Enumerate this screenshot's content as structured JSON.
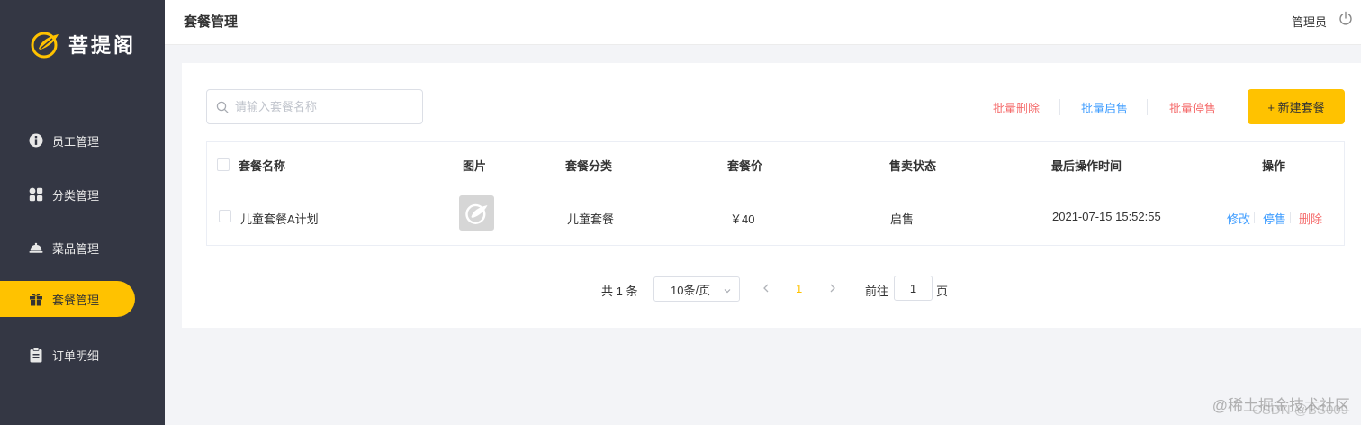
{
  "app": {
    "logo_text": "菩提阁"
  },
  "sidebar": {
    "items": [
      {
        "label": "员工管理",
        "icon": "employee-icon"
      },
      {
        "label": "分类管理",
        "icon": "category-grid-icon"
      },
      {
        "label": "菜品管理",
        "icon": "dish-cloche-icon"
      },
      {
        "label": "套餐管理",
        "icon": "gift-icon",
        "active": true
      },
      {
        "label": "订单明细",
        "icon": "clipboard-icon"
      }
    ]
  },
  "header": {
    "title": "套餐管理",
    "user": "管理员",
    "logout_icon": "power-icon"
  },
  "toolbar": {
    "search_placeholder": "请输入套餐名称",
    "batch_delete": "批量删除",
    "batch_enable": "批量启售",
    "batch_disable": "批量停售",
    "new_button": "+ 新建套餐"
  },
  "table": {
    "headers": [
      "套餐名称",
      "图片",
      "套餐分类",
      "套餐价",
      "售卖状态",
      "最后操作时间",
      "操作"
    ],
    "rows": [
      {
        "name": "儿童套餐A计划",
        "category": "儿童套餐",
        "price": "￥40",
        "status": "启售",
        "updated": "2021-07-15 15:52:55",
        "actions": {
          "edit": "修改",
          "toggle": "停售",
          "delete": "删除"
        }
      }
    ]
  },
  "pagination": {
    "total": "共 1 条",
    "page_size": "10条/页",
    "current_page": "1",
    "goto_label": "前往",
    "goto_value": "1",
    "page_suffix": "页"
  },
  "watermark": {
    "line1": "@稀土掘金技术社区",
    "line2": "CSDN @BS009"
  },
  "colors": {
    "accent": "#ffc200",
    "sidebar": "#343744",
    "link_blue": "#419eff",
    "danger_red": "#f56c6c"
  }
}
